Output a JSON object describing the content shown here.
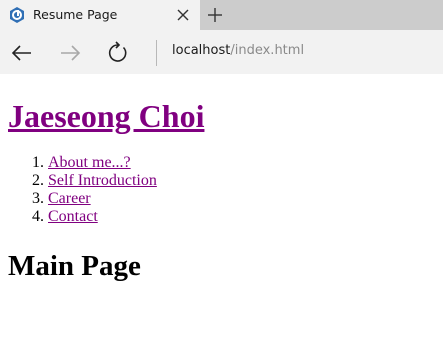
{
  "browser": {
    "tab": {
      "title": "Resume Page",
      "icon": "edge-logo-icon"
    },
    "new_tab_icon": "plus-icon",
    "close_icon": "close-icon",
    "nav": {
      "back_icon": "back-arrow-icon",
      "forward_icon": "forward-arrow-icon",
      "refresh_icon": "refresh-icon"
    },
    "address": {
      "host": "localhost",
      "path": "/index.html"
    },
    "colors": {
      "tabbar_bg": "#cccccc",
      "chrome_bg": "#f2f2f2",
      "visited_link": "#800080"
    }
  },
  "page": {
    "heading": "Jaeseong Choi",
    "nav_items": [
      {
        "label": "About me...?"
      },
      {
        "label": "Self Introduction"
      },
      {
        "label": "Career"
      },
      {
        "label": "Contact"
      }
    ],
    "main_title": "Main Page"
  }
}
